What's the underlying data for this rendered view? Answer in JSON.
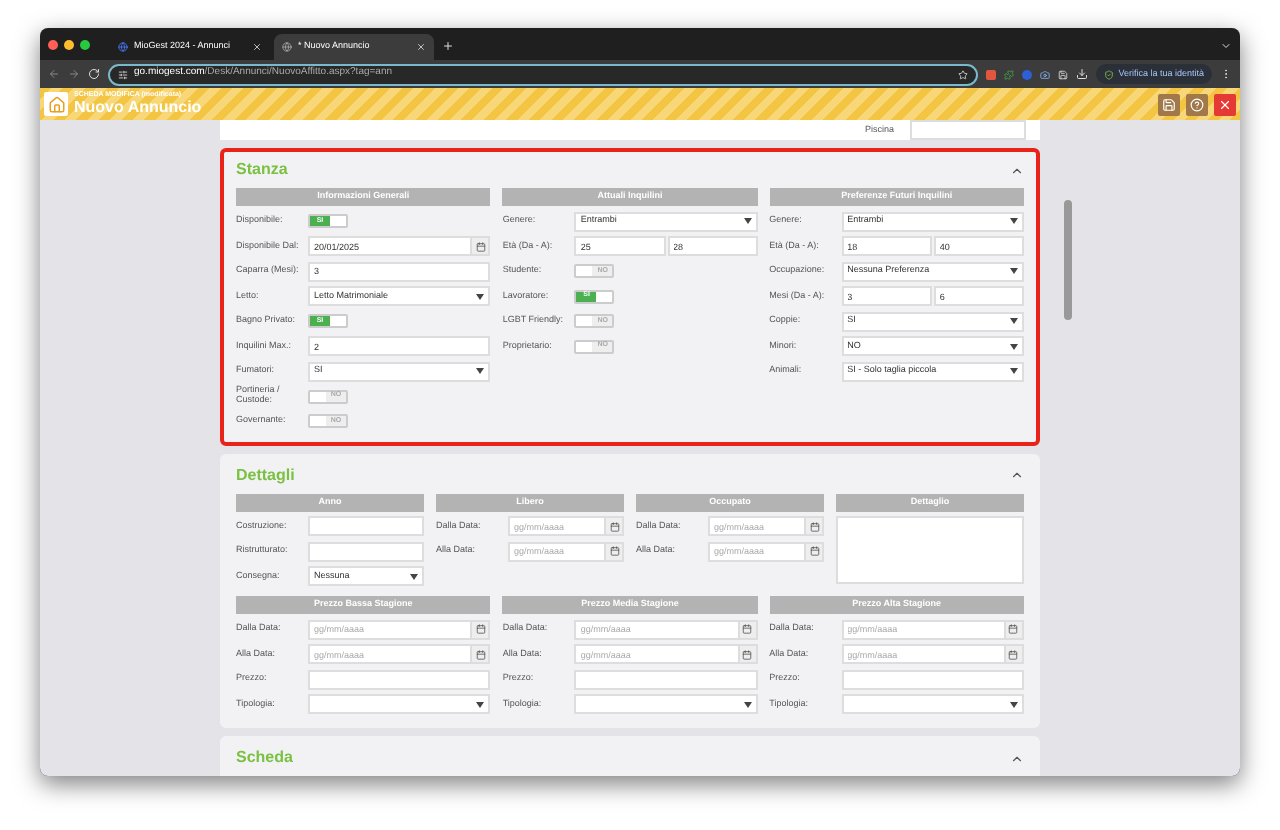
{
  "browser": {
    "tabs": [
      {
        "title": "MioGest 2024 - Annunci",
        "selected": false
      },
      {
        "title": "* Nuovo Annuncio",
        "selected": true
      }
    ],
    "url": {
      "host": "go.miogest.com",
      "path": "/Desk/Annunci/NuovoAffitto.aspx?tag=ann"
    },
    "profile_button": "Verifica la tua identità"
  },
  "app_header": {
    "subtitle": "SCHEDA MODIFICA (modificata)",
    "title": "Nuovo Annuncio"
  },
  "top_field": {
    "label": "Piscina"
  },
  "sections": [
    {
      "title": "Stanza",
      "expanded": true,
      "highlighted": true,
      "blocks": [
        {
          "columns": [
            {
              "header": "Informazioni Generali",
              "rows": [
                {
                  "kind": "toggle",
                  "label": "Disponibile:",
                  "on": true,
                  "text": "SI"
                },
                {
                  "kind": "date",
                  "label": "Disponibile Dal:",
                  "value": "20/01/2025"
                },
                {
                  "kind": "text",
                  "label": "Caparra (Mesi):",
                  "value": "3"
                },
                {
                  "kind": "select",
                  "label": "Letto:",
                  "value": "Letto Matrimoniale"
                },
                {
                  "kind": "toggle",
                  "label": "Bagno Privato:",
                  "on": true,
                  "text": "SI"
                },
                {
                  "kind": "text",
                  "label": "Inquilini Max.:",
                  "value": "2"
                },
                {
                  "kind": "select",
                  "label": "Fumatori:",
                  "value": "SI"
                },
                {
                  "kind": "toggle",
                  "label": "Portineria / Custode:",
                  "on": false,
                  "text": "NO"
                },
                {
                  "kind": "toggle",
                  "label": "Governante:",
                  "on": false,
                  "text": "NO"
                }
              ]
            },
            {
              "header": "Attuali Inquilini",
              "rows": [
                {
                  "kind": "select",
                  "label": "Genere:",
                  "value": "Entrambi"
                },
                {
                  "kind": "range",
                  "label": "Età (Da - A):",
                  "from": "25",
                  "to": "28"
                },
                {
                  "kind": "toggle",
                  "label": "Studente:",
                  "on": false,
                  "text": "NO"
                },
                {
                  "kind": "toggle",
                  "label": "Lavoratore:",
                  "on": true,
                  "text": "SI"
                },
                {
                  "kind": "toggle",
                  "label": "LGBT Friendly:",
                  "on": false,
                  "text": "NO"
                },
                {
                  "kind": "toggle",
                  "label": "Proprietario:",
                  "on": false,
                  "text": "NO"
                }
              ]
            },
            {
              "header": "Preferenze Futuri Inquilini",
              "rows": [
                {
                  "kind": "select",
                  "label": "Genere:",
                  "value": "Entrambi"
                },
                {
                  "kind": "range",
                  "label": "Età (Da - A):",
                  "from": "18",
                  "to": "40"
                },
                {
                  "kind": "select",
                  "label": "Occupazione:",
                  "value": "Nessuna Preferenza"
                },
                {
                  "kind": "range",
                  "label": "Mesi (Da - A):",
                  "from": "3",
                  "to": "6"
                },
                {
                  "kind": "select",
                  "label": "Coppie:",
                  "value": "SI"
                },
                {
                  "kind": "select",
                  "label": "Minori:",
                  "value": "NO"
                },
                {
                  "kind": "select",
                  "label": "Animali:",
                  "value": "SI - Solo taglia piccola"
                }
              ]
            }
          ]
        }
      ]
    },
    {
      "title": "Dettagli",
      "expanded": true,
      "highlighted": false,
      "blocks": [
        {
          "columns": [
            {
              "header": "Anno",
              "rows": [
                {
                  "kind": "text",
                  "label": "Costruzione:"
                },
                {
                  "kind": "text",
                  "label": "Ristrutturato:"
                },
                {
                  "kind": "select",
                  "label": "Consegna:",
                  "value": "Nessuna"
                }
              ]
            },
            {
              "header": "Libero",
              "rows": [
                {
                  "kind": "date",
                  "label": "Dalla Data:",
                  "placeholder": "gg/mm/aaaa"
                },
                {
                  "kind": "date",
                  "label": "Alla Data:",
                  "placeholder": "gg/mm/aaaa"
                }
              ]
            },
            {
              "header": "Occupato",
              "rows": [
                {
                  "kind": "date",
                  "label": "Dalla Data:",
                  "placeholder": "gg/mm/aaaa"
                },
                {
                  "kind": "date",
                  "label": "Alla Data:",
                  "placeholder": "gg/mm/aaaa"
                }
              ]
            },
            {
              "header": "Dettaglio",
              "rows": [
                {
                  "kind": "textarea"
                }
              ]
            }
          ]
        },
        {
          "columns": [
            {
              "header": "Prezzo Bassa Stagione",
              "rows": [
                {
                  "kind": "date",
                  "label": "Dalla Data:",
                  "placeholder": "gg/mm/aaaa"
                },
                {
                  "kind": "date",
                  "label": "Alla Data:",
                  "placeholder": "gg/mm/aaaa"
                },
                {
                  "kind": "text",
                  "label": "Prezzo:"
                },
                {
                  "kind": "select",
                  "label": "Tipologia:"
                }
              ]
            },
            {
              "header": "Prezzo Media Stagione",
              "rows": [
                {
                  "kind": "date",
                  "label": "Dalla Data:",
                  "placeholder": "gg/mm/aaaa"
                },
                {
                  "kind": "date",
                  "label": "Alla Data:",
                  "placeholder": "gg/mm/aaaa"
                },
                {
                  "kind": "text",
                  "label": "Prezzo:"
                },
                {
                  "kind": "select",
                  "label": "Tipologia:"
                }
              ]
            },
            {
              "header": "Prezzo Alta Stagione",
              "rows": [
                {
                  "kind": "date",
                  "label": "Dalla Data:",
                  "placeholder": "gg/mm/aaaa"
                },
                {
                  "kind": "date",
                  "label": "Alla Data:",
                  "placeholder": "gg/mm/aaaa"
                },
                {
                  "kind": "text",
                  "label": "Prezzo:"
                },
                {
                  "kind": "select",
                  "label": "Tipologia:"
                }
              ]
            }
          ]
        }
      ]
    },
    {
      "title": "Scheda",
      "expanded": true,
      "highlighted": false
    }
  ]
}
